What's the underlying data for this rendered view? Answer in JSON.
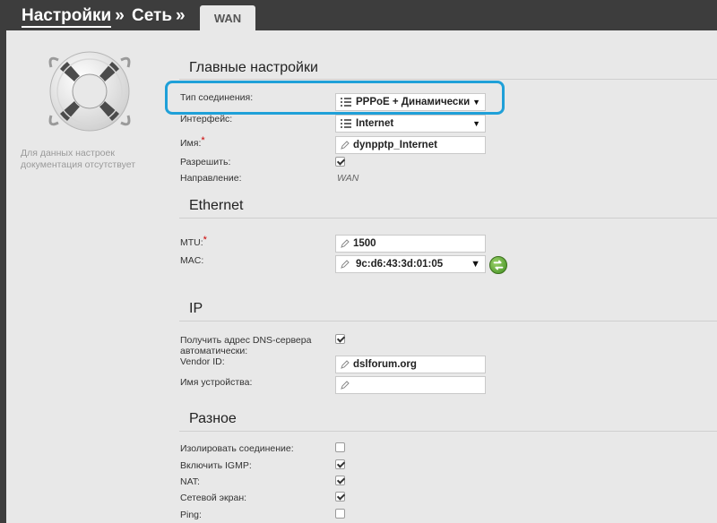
{
  "breadcrumb": {
    "item1": "Настройки",
    "item2": "Сеть",
    "separator": "»"
  },
  "tab": {
    "label": "WAN"
  },
  "sidebar": {
    "no_doc_text": "Для данных настроек документация отсутствует"
  },
  "main_settings": {
    "title": "Главные настройки",
    "connection_type_label": "Тип соединения:",
    "connection_type_value": "PPPoE + Динамический",
    "interface_label": "Интерфейс:",
    "interface_value": "Internet",
    "name_label": "Имя:",
    "name_value": "dynpptp_Internet",
    "enable_label": "Разрешить:",
    "enable_checked": true,
    "direction_label": "Направление:",
    "direction_value": "WAN"
  },
  "ethernet": {
    "title": "Ethernet",
    "mtu_label": "MTU:",
    "mtu_value": "1500",
    "mac_label": "MAC:",
    "mac_value": "9c:d6:43:3d:01:05"
  },
  "ip": {
    "title": "IP",
    "dns_auto_label_line1": "Получить адрес DNS-сервера",
    "dns_auto_label_line2": "автоматически:",
    "dns_auto_checked": true,
    "vendor_id_label": "Vendor ID:",
    "vendor_id_value": "dslforum.org",
    "device_name_label": "Имя устройства:",
    "device_name_value": ""
  },
  "misc": {
    "title": "Разное",
    "isolate_label": "Изолировать соединение:",
    "isolate_checked": false,
    "igmp_label": "Включить IGMP:",
    "igmp_checked": true,
    "nat_label": "NAT:",
    "nat_checked": true,
    "firewall_label": "Сетевой экран:",
    "firewall_checked": true,
    "ping_label": "Ping:",
    "ping_checked": false
  },
  "required_mark": "*",
  "colors": {
    "highlight": "#1fa0d8",
    "topbar": "#3d3d3d",
    "panel": "#e8e8e8"
  }
}
